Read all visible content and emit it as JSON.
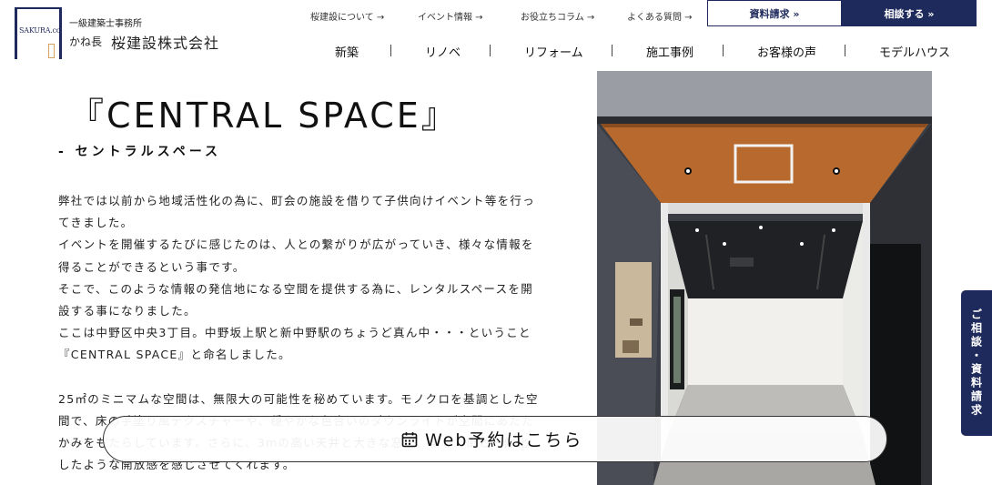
{
  "logo": {
    "word": "SAKURA.co",
    "sub": "一級建築士事務所",
    "kane": "かね長",
    "name": "桜建設株式会社"
  },
  "top_links": [
    {
      "label": "桜建設について →"
    },
    {
      "label": "イベント情報 →"
    },
    {
      "label": "お役立ちコラム →"
    },
    {
      "label": "よくある質問 →"
    }
  ],
  "buttons": {
    "doc_request": "資料請求 »",
    "consult": "相談する »"
  },
  "main_nav": [
    {
      "label": "新築"
    },
    {
      "label": "リノベ"
    },
    {
      "label": "リフォーム"
    },
    {
      "label": "施工事例"
    },
    {
      "label": "お客様の声"
    },
    {
      "label": "モデルハウス"
    }
  ],
  "content": {
    "title": "『CENTRAL SPACE』",
    "subtitle": "- セントラルスペース",
    "paragraphs": [
      "弊社では以前から地域活性化の為に、町会の施設を借りて子供向けイベント等を行ってきました。",
      "イベントを開催するたびに感じたのは、人との繋がりが広がっていき、様々な情報を得ることができるという事です。",
      "そこで、このような情報の発信地になる空間を提供する為に、レンタルスペースを開設する事になりました。",
      "ここは中野区中央3丁目。中野坂上駅と新中野駅のちょうど真ん中・・・ということ『CENTRAL SPACE』と命名しました。",
      "25㎡のミニマムな空間は、無限大の可能性を秘めています。モノクロを基調とした空間で、床の手塗り風テクスチャーや、穏やかな色合いのダウンライトが空間にあたたかみをもたらしています。さらに、3mの高い天井と大きな窓で、まるで街と一体化したような開放感を感じさせてくれます。"
    ]
  },
  "side_tab": "ご相談・資料請求",
  "web_booking": "Web予約はこちら",
  "colors": {
    "navy": "#1f2a5c",
    "wood": "#b86a2e"
  }
}
